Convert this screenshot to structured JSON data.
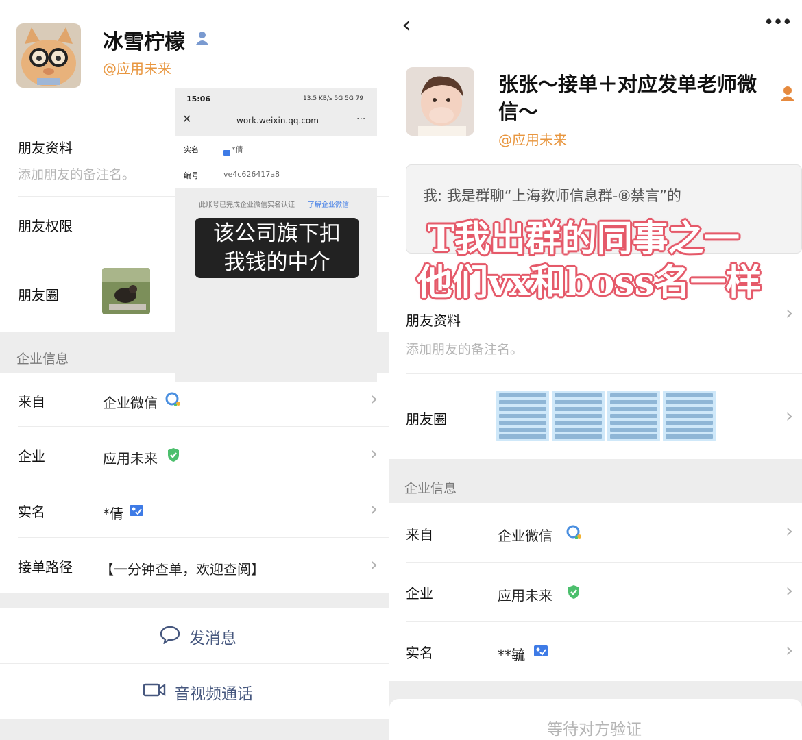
{
  "left": {
    "name": "冰雪柠檬",
    "handle": "@应用未来",
    "friend_info_label": "朋友资料",
    "remark_hint": "添加朋友的备注名。",
    "permissions_label": "朋友权限",
    "moments_label": "朋友圈",
    "section_title": "企业信息",
    "rows": [
      {
        "label": "来自",
        "value": "企业微信"
      },
      {
        "label": "企业",
        "value": "应用未来"
      },
      {
        "label": "实名",
        "value": "*倩"
      },
      {
        "label": "接单路径",
        "value": "【一分钟查单，欢迎查阅】"
      }
    ],
    "send_message": "发消息",
    "av_call": "音视频通话"
  },
  "overlay": {
    "time": "15:06",
    "status": "13.5 KB/s  5G  5G  79",
    "url": "work.weixin.qq.com",
    "more": "···",
    "realname_label": "实名",
    "realname_value": "*倩",
    "id_label": "编号",
    "id_value": "ve4c626417a8",
    "cert_text": "此账号已完成企业微信实名认证",
    "cert_link": "了解企业微信",
    "caption_line1": "该公司旗下扣",
    "caption_line2": "我钱的中介"
  },
  "right": {
    "name_line1": "张张～接单＋对应发单老师微",
    "name_line2": "信～",
    "handle": "@应用未来",
    "message": "我: 我是群聊“上海教师信息群-⑧禁言”的",
    "meme_line1": "T我出群的同事之一",
    "meme_line2": "他们vx和boss名一样",
    "friend_info_label": "朋友资料",
    "remark_hint": "添加朋友的备注名。",
    "moments_label": "朋友圈",
    "section_title": "企业信息",
    "rows": [
      {
        "label": "来自",
        "value": "企业微信"
      },
      {
        "label": "企业",
        "value": "应用未来"
      },
      {
        "label": "实名",
        "value": "**毓"
      }
    ],
    "waiting": "等待对方验证"
  },
  "icons": {
    "back": "chevron-left-icon",
    "more": "more-dots-icon",
    "verified": "shield-check-icon",
    "realname_card": "id-card-icon",
    "wecom": "wecom-icon",
    "person": "person-icon",
    "chat": "chat-bubble-icon",
    "video": "video-camera-icon"
  },
  "colors": {
    "handle": "#e8963f",
    "action": "#46577e",
    "verified": "#4cbf6d",
    "section_bg": "#ededed",
    "meme_outline": "#e55a6a"
  }
}
